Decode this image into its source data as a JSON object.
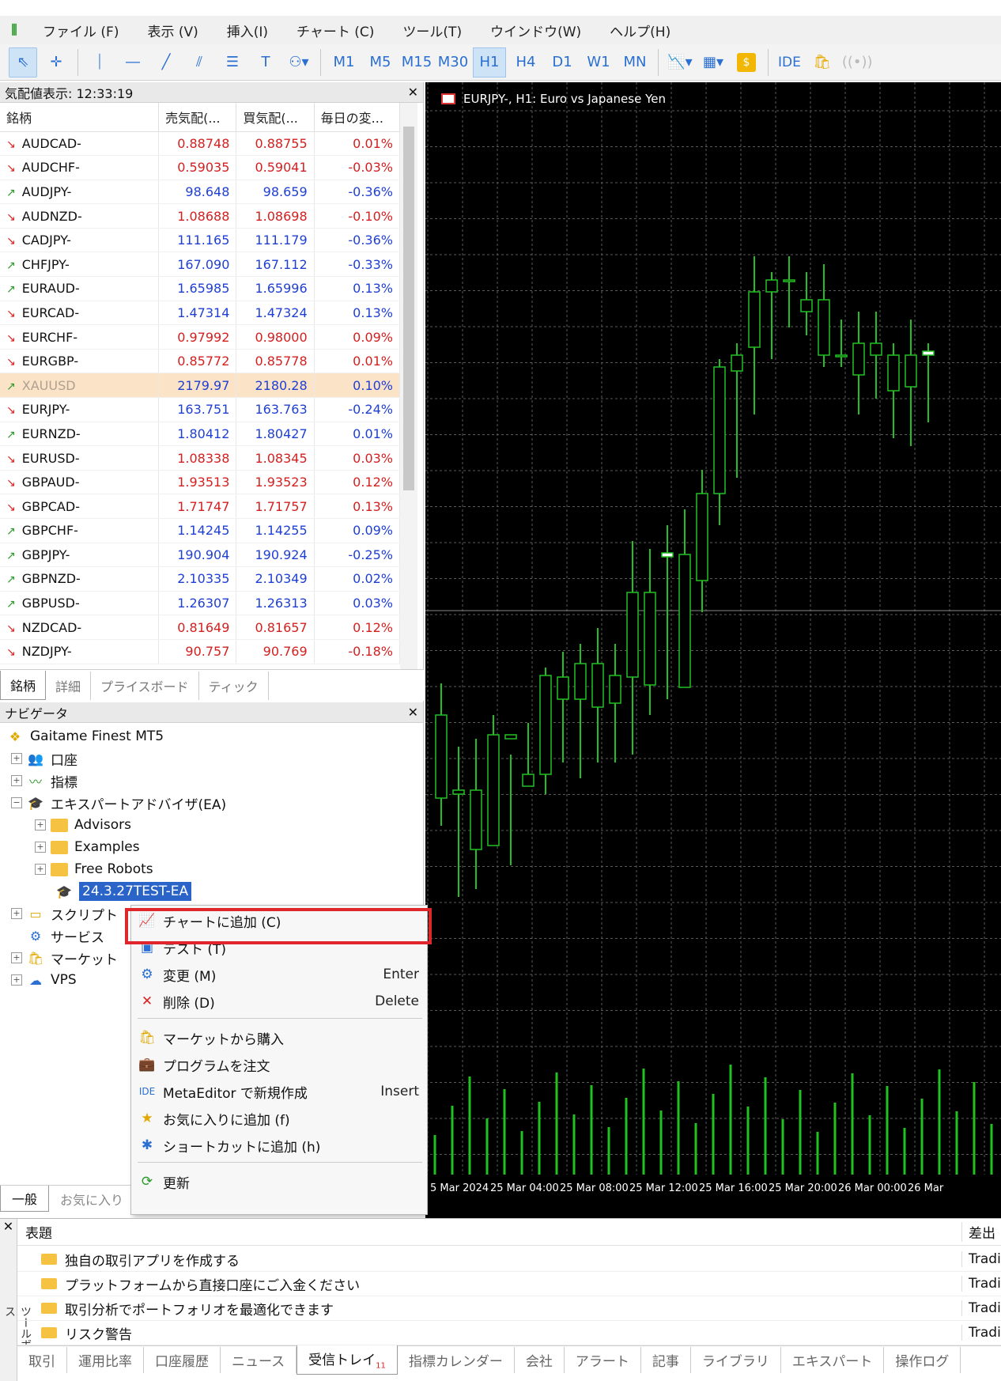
{
  "menubar": {
    "items": [
      "ファイル (F)",
      "表示 (V)",
      "挿入(I)",
      "チャート (C)",
      "ツール(T)",
      "ウインドウ(W)",
      "ヘルプ(H)"
    ]
  },
  "toolbar": {
    "tools": [
      {
        "icon": "cursor-icon",
        "glyph": "⇖",
        "active": true
      },
      {
        "icon": "crosshair-icon",
        "glyph": "✛"
      },
      {
        "icon": "vertical-line-icon",
        "glyph": "⏐"
      },
      {
        "icon": "horizontal-line-icon",
        "glyph": "―"
      },
      {
        "icon": "trendline-icon",
        "glyph": "╱"
      },
      {
        "icon": "channel-icon",
        "glyph": "⫽"
      },
      {
        "icon": "fibonacci-icon",
        "glyph": "☰"
      },
      {
        "icon": "text-icon",
        "glyph": "T"
      },
      {
        "icon": "shapes-icon",
        "glyph": "⚇▾"
      }
    ],
    "timeframes": [
      "M1",
      "M5",
      "M15",
      "M30",
      "H1",
      "H4",
      "D1",
      "W1",
      "MN"
    ],
    "active_timeframe": "H1",
    "ide_label": "IDE"
  },
  "market_watch": {
    "title": "気配値表示: 12:33:19",
    "columns": [
      "銘柄",
      "売気配(...",
      "買気配(...",
      "毎日の変..."
    ],
    "rows": [
      {
        "symbol": "AUDCAD-",
        "dir": "down",
        "bid": "0.88748",
        "ask": "0.88755",
        "change": "0.01%",
        "color": "red"
      },
      {
        "symbol": "AUDCHF-",
        "dir": "down",
        "bid": "0.59035",
        "ask": "0.59041",
        "change": "-0.03%",
        "color": "red"
      },
      {
        "symbol": "AUDJPY-",
        "dir": "up",
        "bid": "98.648",
        "ask": "98.659",
        "change": "-0.36%",
        "color": "blue"
      },
      {
        "symbol": "AUDNZD-",
        "dir": "down",
        "bid": "1.08688",
        "ask": "1.08698",
        "change": "-0.10%",
        "color": "red"
      },
      {
        "symbol": "CADJPY-",
        "dir": "down",
        "bid": "111.165",
        "ask": "111.179",
        "change": "-0.36%",
        "color": "blue"
      },
      {
        "symbol": "CHFJPY-",
        "dir": "up",
        "bid": "167.090",
        "ask": "167.112",
        "change": "-0.33%",
        "color": "blue"
      },
      {
        "symbol": "EURAUD-",
        "dir": "up",
        "bid": "1.65985",
        "ask": "1.65996",
        "change": "0.13%",
        "color": "blue"
      },
      {
        "symbol": "EURCAD-",
        "dir": "down",
        "bid": "1.47314",
        "ask": "1.47324",
        "change": "0.13%",
        "color": "blue"
      },
      {
        "symbol": "EURCHF-",
        "dir": "down",
        "bid": "0.97992",
        "ask": "0.98000",
        "change": "0.09%",
        "color": "red"
      },
      {
        "symbol": "EURGBP-",
        "dir": "down",
        "bid": "0.85772",
        "ask": "0.85778",
        "change": "0.01%",
        "color": "red"
      },
      {
        "symbol": "XAUUSD",
        "dir": "up",
        "bid": "2179.97",
        "ask": "2180.28",
        "change": "0.10%",
        "color": "blue",
        "highlight": true
      },
      {
        "symbol": "EURJPY-",
        "dir": "down",
        "bid": "163.751",
        "ask": "163.763",
        "change": "-0.24%",
        "color": "blue"
      },
      {
        "symbol": "EURNZD-",
        "dir": "up",
        "bid": "1.80412",
        "ask": "1.80427",
        "change": "0.01%",
        "color": "blue"
      },
      {
        "symbol": "EURUSD-",
        "dir": "down",
        "bid": "1.08338",
        "ask": "1.08345",
        "change": "0.03%",
        "color": "red"
      },
      {
        "symbol": "GBPAUD-",
        "dir": "down",
        "bid": "1.93513",
        "ask": "1.93523",
        "change": "0.12%",
        "color": "red"
      },
      {
        "symbol": "GBPCAD-",
        "dir": "down",
        "bid": "1.71747",
        "ask": "1.71757",
        "change": "0.13%",
        "color": "red"
      },
      {
        "symbol": "GBPCHF-",
        "dir": "up",
        "bid": "1.14245",
        "ask": "1.14255",
        "change": "0.09%",
        "color": "blue"
      },
      {
        "symbol": "GBPJPY-",
        "dir": "up",
        "bid": "190.904",
        "ask": "190.924",
        "change": "-0.25%",
        "color": "blue"
      },
      {
        "symbol": "GBPNZD-",
        "dir": "up",
        "bid": "2.10335",
        "ask": "2.10349",
        "change": "0.02%",
        "color": "blue"
      },
      {
        "symbol": "GBPUSD-",
        "dir": "up",
        "bid": "1.26307",
        "ask": "1.26313",
        "change": "0.03%",
        "color": "blue"
      },
      {
        "symbol": "NZDCAD-",
        "dir": "down",
        "bid": "0.81649",
        "ask": "0.81657",
        "change": "0.12%",
        "color": "red"
      },
      {
        "symbol": "NZDJPY-",
        "dir": "down",
        "bid": "90.757",
        "ask": "90.769",
        "change": "-0.18%",
        "color": "red"
      }
    ],
    "tabs": [
      "銘柄",
      "詳細",
      "プライスボード",
      "ティック"
    ]
  },
  "navigator": {
    "title": "ナビゲータ",
    "root": "Gaitame Finest MT5",
    "items": {
      "account": "口座",
      "indicators": "指標",
      "ea": "エキスパートアドバイザ(EA)",
      "advisors": "Advisors",
      "examples": "Examples",
      "free_robots": "Free Robots",
      "selected_ea": "24.3.27TEST-EA",
      "scripts": "スクリプト",
      "services": "サービス",
      "market": "マーケット",
      "vps": "VPS"
    },
    "tabs": [
      "一般",
      "お気に入り"
    ]
  },
  "chart": {
    "title": "EURJPY-, H1:  Euro vs Japanese Yen",
    "time_labels": [
      "5 Mar 2024",
      "25 Mar 04:00",
      "25 Mar 08:00",
      "25 Mar 12:00",
      "25 Mar 16:00",
      "25 Mar 20:00",
      "26 Mar 00:00",
      "26 Mar"
    ]
  },
  "context_menu": {
    "items": [
      {
        "icon": "chart-add-icon",
        "glyph": "📈",
        "label": "チャートに追加 (C)",
        "shortcut": ""
      },
      {
        "icon": "test-icon",
        "glyph": "▣",
        "label": "テスト (T)",
        "shortcut": ""
      },
      {
        "icon": "modify-icon",
        "glyph": "⚙",
        "label": "変更 (M)",
        "shortcut": "Enter"
      },
      {
        "icon": "delete-icon",
        "glyph": "✕",
        "label": "削除 (D)",
        "shortcut": "Delete"
      },
      {
        "icon": "market-buy-icon",
        "glyph": "🛍",
        "label": "マーケットから購入",
        "shortcut": ""
      },
      {
        "icon": "order-program-icon",
        "glyph": "💼",
        "label": "プログラムを注文",
        "shortcut": ""
      },
      {
        "icon": "metaeditor-icon",
        "glyph": "IDE",
        "label": "MetaEditor で新規作成",
        "shortcut": "Insert"
      },
      {
        "icon": "favorite-icon",
        "glyph": "★",
        "label": "お気に入りに追加 (f)",
        "shortcut": ""
      },
      {
        "icon": "shortcut-icon",
        "glyph": "✱",
        "label": "ショートカットに追加 (h)",
        "shortcut": ""
      },
      {
        "icon": "refresh-icon",
        "glyph": "⟳",
        "label": "更新",
        "shortcut": ""
      }
    ]
  },
  "toolbox": {
    "side_label": "ツールボックス",
    "columns": [
      "表題",
      "差出"
    ],
    "rows": [
      {
        "title": "独自の取引アプリを作成する",
        "from": "Tradi"
      },
      {
        "title": "プラットフォームから直接口座にご入金ください",
        "from": "Tradi"
      },
      {
        "title": "取引分析でポートフォリオを最適化できます",
        "from": "Tradi"
      },
      {
        "title": "リスク警告",
        "from": "Tradi"
      }
    ],
    "tabs": [
      "取引",
      "運用比率",
      "口座履歴",
      "ニュース",
      "受信トレイ",
      "指標カレンダー",
      "会社",
      "アラート",
      "記事",
      "ライブラリ",
      "エキスパート",
      "操作ログ"
    ],
    "active_tab": "受信トレイ",
    "inbox_count": "11"
  },
  "colors": {
    "chart_bg": "#000000",
    "candle": "#22c122",
    "candle_body_bull": "#ffffff",
    "grid": "#5a5a5a",
    "highlight_red": "#e0262d",
    "selection": "#2b64c9"
  }
}
